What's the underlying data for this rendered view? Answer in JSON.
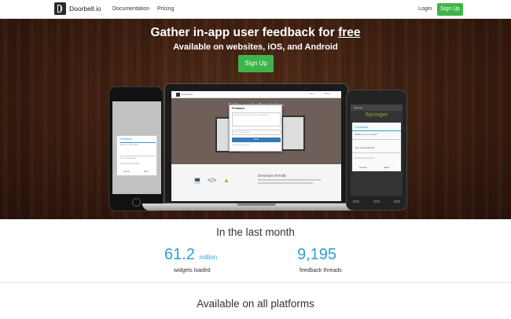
{
  "navbar": {
    "brand": "Doorbell.io",
    "links": [
      "Documentation",
      "Pricing"
    ],
    "login": "Login",
    "signup": "Sign Up"
  },
  "hero": {
    "title_prefix": "Gather in-app user feedback for ",
    "title_emphasis": "free",
    "subtitle": "Available on websites, iOS, and Android",
    "cta": "Sign Up",
    "background_color": "#3f1f10",
    "accent_color": "#3eb54a"
  },
  "iphone_mock": {
    "title": "Feedback",
    "message_placeholder": "What's on your mind?",
    "email_placeholder": "Your email address",
    "powered_by": "Powered by Doorbell.io",
    "cancel": "Cancel",
    "send": "Send"
  },
  "laptop_mock": {
    "nav_brand": "Doorbell.io",
    "nav_links": [
      "Docs",
      "Pricing"
    ],
    "hero_title": "Gather user feedback for free.",
    "modal_title": "Feedback",
    "message_placeholder": "Send us your comments or suggestions...",
    "email_placeholder": "Your email address",
    "send": "Send",
    "powered_by": "Powered by Doorbell.io",
    "feature_title": "Developer friendly",
    "feature_icons": [
      "laptop-icon",
      "code-icon",
      "android-icon"
    ]
  },
  "android_mock": {
    "app_bar": "Springer",
    "banner": "Springer",
    "title": "Feedback",
    "message_placeholder": "What's on your mind?",
    "email_placeholder": "Your email address",
    "powered_by": "Powered by Doorbell.io",
    "cancel": "Cancel",
    "send": "Send"
  },
  "stats": {
    "title": "In the last month",
    "items": [
      {
        "value": "61.2",
        "unit": "million",
        "label": "widgets loaded"
      },
      {
        "value": "9,195",
        "unit": "",
        "label": "feedback threads"
      }
    ],
    "value_color": "#29a0d8"
  },
  "platforms": {
    "title": "Available on all platforms"
  }
}
